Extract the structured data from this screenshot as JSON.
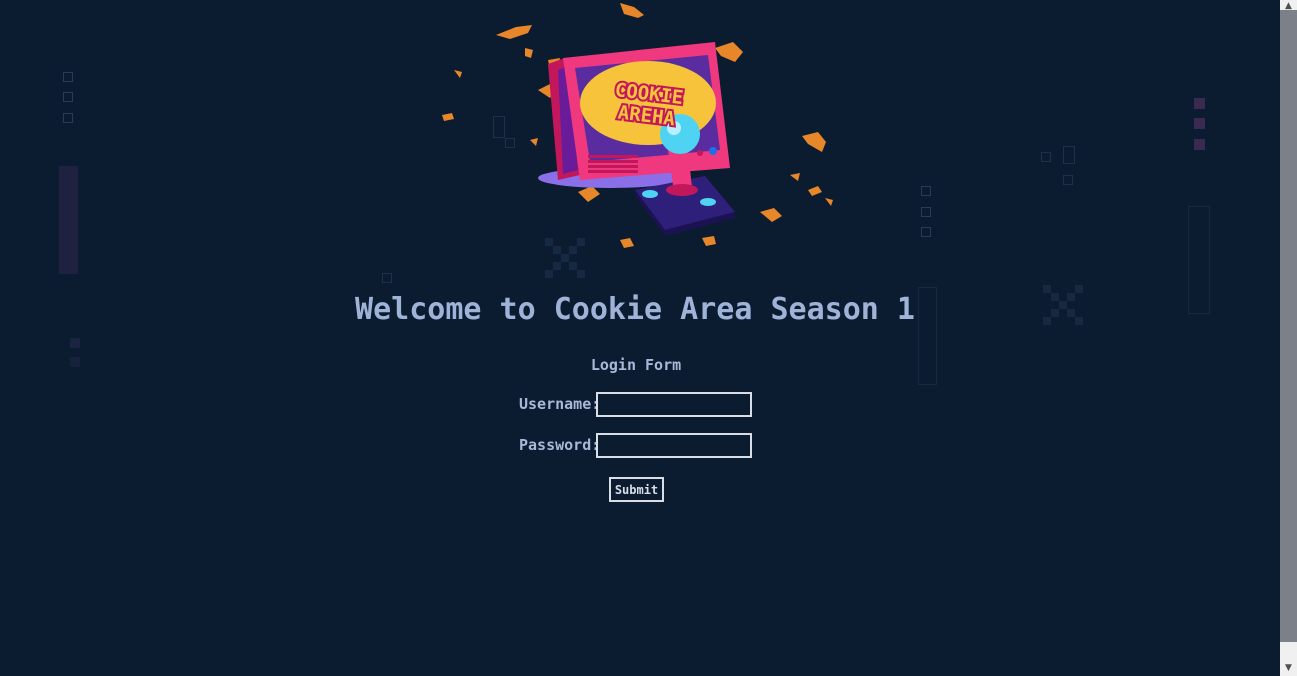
{
  "page": {
    "title": "Welcome to Cookie Area Season 1",
    "logo_text_line1": "COOKIE",
    "logo_text_line2": "AREHA"
  },
  "form": {
    "heading": "Login Form",
    "username_label": "Username:",
    "username_value": "",
    "password_label": "Password:",
    "password_value": "",
    "submit_label": "Submit"
  },
  "scrollbar": {
    "up_arrow": "▲",
    "down_arrow": "▼"
  },
  "colors": {
    "background": "#0b1c30",
    "title": "#9fb3d9",
    "label": "#a8b8d8",
    "field_border": "#d8dde6",
    "monitor_pink": "#f0387f",
    "screen_yellow": "#f7c33b",
    "ball_cyan": "#4fd3f2"
  }
}
